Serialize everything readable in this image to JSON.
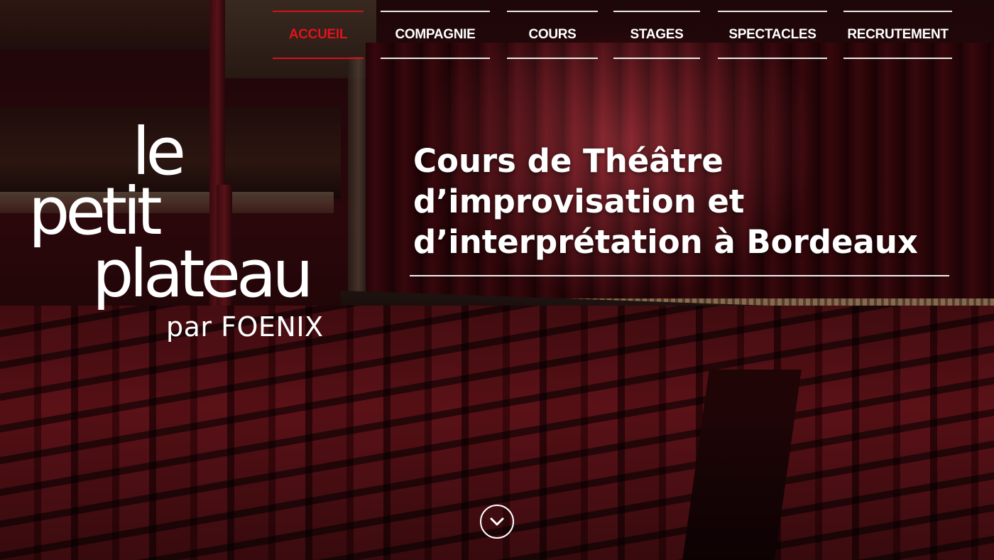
{
  "nav": {
    "items": [
      {
        "label": "ACCUEIL",
        "active": true
      },
      {
        "label": "COMPAGNIE",
        "active": false
      },
      {
        "label": "COURS",
        "active": false
      },
      {
        "label": "STAGES",
        "active": false
      },
      {
        "label": "SPECTACLES",
        "active": false
      },
      {
        "label": "RECRUTEMENT",
        "active": false
      }
    ]
  },
  "logo": {
    "line1": "le",
    "line2": "petit",
    "line3": "plateau",
    "tagline": "par FOENIX"
  },
  "hero": {
    "headline_lines": [
      "Cours de Théâtre",
      "d’improvisation et",
      "d’interprétation à Bordeaux"
    ],
    "background": "theatre-auditorium-red-curtain",
    "scroll_icon": "chevron-down-icon"
  },
  "colors": {
    "accent": "#e0141c",
    "text": "#ffffff"
  }
}
